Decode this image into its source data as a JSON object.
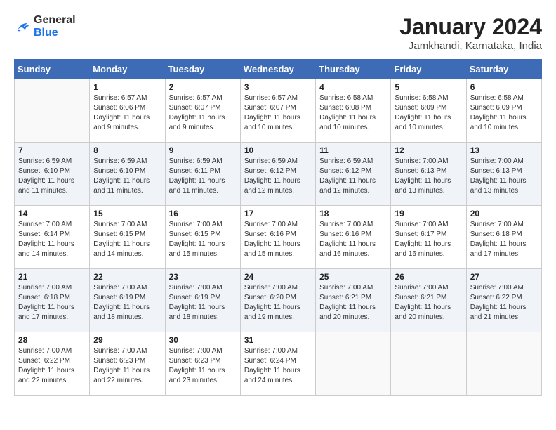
{
  "header": {
    "logo_general": "General",
    "logo_blue": "Blue",
    "month_year": "January 2024",
    "location": "Jamkhandi, Karnataka, India"
  },
  "weekdays": [
    "Sunday",
    "Monday",
    "Tuesday",
    "Wednesday",
    "Thursday",
    "Friday",
    "Saturday"
  ],
  "weeks": [
    [
      {
        "day": "",
        "empty": true
      },
      {
        "day": "1",
        "sunrise": "6:57 AM",
        "sunset": "6:06 PM",
        "daylight": "11 hours and 9 minutes."
      },
      {
        "day": "2",
        "sunrise": "6:57 AM",
        "sunset": "6:07 PM",
        "daylight": "11 hours and 9 minutes."
      },
      {
        "day": "3",
        "sunrise": "6:57 AM",
        "sunset": "6:07 PM",
        "daylight": "11 hours and 10 minutes."
      },
      {
        "day": "4",
        "sunrise": "6:58 AM",
        "sunset": "6:08 PM",
        "daylight": "11 hours and 10 minutes."
      },
      {
        "day": "5",
        "sunrise": "6:58 AM",
        "sunset": "6:09 PM",
        "daylight": "11 hours and 10 minutes."
      },
      {
        "day": "6",
        "sunrise": "6:58 AM",
        "sunset": "6:09 PM",
        "daylight": "11 hours and 10 minutes."
      }
    ],
    [
      {
        "day": "7",
        "sunrise": "6:59 AM",
        "sunset": "6:10 PM",
        "daylight": "11 hours and 11 minutes."
      },
      {
        "day": "8",
        "sunrise": "6:59 AM",
        "sunset": "6:10 PM",
        "daylight": "11 hours and 11 minutes."
      },
      {
        "day": "9",
        "sunrise": "6:59 AM",
        "sunset": "6:11 PM",
        "daylight": "11 hours and 11 minutes."
      },
      {
        "day": "10",
        "sunrise": "6:59 AM",
        "sunset": "6:12 PM",
        "daylight": "11 hours and 12 minutes."
      },
      {
        "day": "11",
        "sunrise": "6:59 AM",
        "sunset": "6:12 PM",
        "daylight": "11 hours and 12 minutes."
      },
      {
        "day": "12",
        "sunrise": "7:00 AM",
        "sunset": "6:13 PM",
        "daylight": "11 hours and 13 minutes."
      },
      {
        "day": "13",
        "sunrise": "7:00 AM",
        "sunset": "6:13 PM",
        "daylight": "11 hours and 13 minutes."
      }
    ],
    [
      {
        "day": "14",
        "sunrise": "7:00 AM",
        "sunset": "6:14 PM",
        "daylight": "11 hours and 14 minutes."
      },
      {
        "day": "15",
        "sunrise": "7:00 AM",
        "sunset": "6:15 PM",
        "daylight": "11 hours and 14 minutes."
      },
      {
        "day": "16",
        "sunrise": "7:00 AM",
        "sunset": "6:15 PM",
        "daylight": "11 hours and 15 minutes."
      },
      {
        "day": "17",
        "sunrise": "7:00 AM",
        "sunset": "6:16 PM",
        "daylight": "11 hours and 15 minutes."
      },
      {
        "day": "18",
        "sunrise": "7:00 AM",
        "sunset": "6:16 PM",
        "daylight": "11 hours and 16 minutes."
      },
      {
        "day": "19",
        "sunrise": "7:00 AM",
        "sunset": "6:17 PM",
        "daylight": "11 hours and 16 minutes."
      },
      {
        "day": "20",
        "sunrise": "7:00 AM",
        "sunset": "6:18 PM",
        "daylight": "11 hours and 17 minutes."
      }
    ],
    [
      {
        "day": "21",
        "sunrise": "7:00 AM",
        "sunset": "6:18 PM",
        "daylight": "11 hours and 17 minutes."
      },
      {
        "day": "22",
        "sunrise": "7:00 AM",
        "sunset": "6:19 PM",
        "daylight": "11 hours and 18 minutes."
      },
      {
        "day": "23",
        "sunrise": "7:00 AM",
        "sunset": "6:19 PM",
        "daylight": "11 hours and 18 minutes."
      },
      {
        "day": "24",
        "sunrise": "7:00 AM",
        "sunset": "6:20 PM",
        "daylight": "11 hours and 19 minutes."
      },
      {
        "day": "25",
        "sunrise": "7:00 AM",
        "sunset": "6:21 PM",
        "daylight": "11 hours and 20 minutes."
      },
      {
        "day": "26",
        "sunrise": "7:00 AM",
        "sunset": "6:21 PM",
        "daylight": "11 hours and 20 minutes."
      },
      {
        "day": "27",
        "sunrise": "7:00 AM",
        "sunset": "6:22 PM",
        "daylight": "11 hours and 21 minutes."
      }
    ],
    [
      {
        "day": "28",
        "sunrise": "7:00 AM",
        "sunset": "6:22 PM",
        "daylight": "11 hours and 22 minutes."
      },
      {
        "day": "29",
        "sunrise": "7:00 AM",
        "sunset": "6:23 PM",
        "daylight": "11 hours and 22 minutes."
      },
      {
        "day": "30",
        "sunrise": "7:00 AM",
        "sunset": "6:23 PM",
        "daylight": "11 hours and 23 minutes."
      },
      {
        "day": "31",
        "sunrise": "7:00 AM",
        "sunset": "6:24 PM",
        "daylight": "11 hours and 24 minutes."
      },
      {
        "day": "",
        "empty": true
      },
      {
        "day": "",
        "empty": true
      },
      {
        "day": "",
        "empty": true
      }
    ]
  ],
  "labels": {
    "sunrise": "Sunrise:",
    "sunset": "Sunset:",
    "daylight": "Daylight:"
  }
}
